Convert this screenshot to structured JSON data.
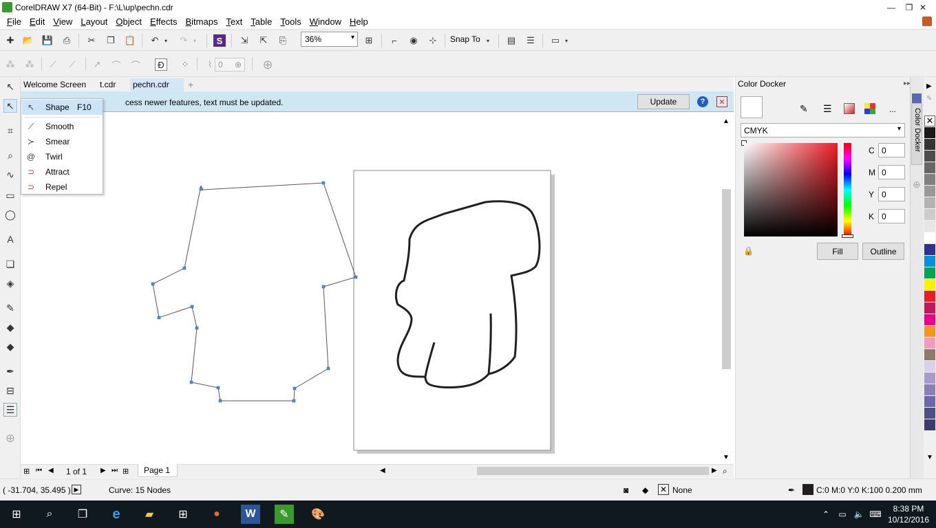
{
  "window": {
    "title": "CorelDRAW X7 (64-Bit) - F:\\L\\up\\pechn.cdr"
  },
  "menu": [
    {
      "label": "File",
      "key": "F",
      "rest": "ile"
    },
    {
      "label": "Edit",
      "key": "E",
      "rest": "dit"
    },
    {
      "label": "View",
      "key": "V",
      "rest": "iew"
    },
    {
      "label": "Layout",
      "key": "L",
      "rest": "ayout"
    },
    {
      "label": "Object",
      "key": "O",
      "rest": "bject"
    },
    {
      "label": "Effects",
      "key": "E",
      "rest": "ffects"
    },
    {
      "label": "Bitmaps",
      "key": "B",
      "rest": "itmaps"
    },
    {
      "label": "Text",
      "key": "T",
      "rest": "ext"
    },
    {
      "label": "Table",
      "key": "T",
      "rest": "able"
    },
    {
      "label": "Tools",
      "key": "T",
      "rest": "ools"
    },
    {
      "label": "Window",
      "key": "W",
      "rest": "indow"
    },
    {
      "label": "Help",
      "key": "H",
      "rest": "elp"
    }
  ],
  "toolbar": {
    "zoom": "36%",
    "snap_to": "Snap To",
    "nudge_value": "0"
  },
  "tabs": [
    {
      "label": "Welcome Screen"
    },
    {
      "label": "t.cdr"
    },
    {
      "label": "pechn.cdr"
    }
  ],
  "infobar": {
    "text": "cess newer features, text must be updated.",
    "update_label": "Update",
    "help_glyph": "?",
    "close_glyph": "✕"
  },
  "flyout": [
    {
      "label": "Shape",
      "shortcut": "F10",
      "icon": "shape-tool-icon"
    },
    {
      "label": "Smooth",
      "shortcut": "",
      "icon": "smooth-tool-icon"
    },
    {
      "label": "Smear",
      "shortcut": "",
      "icon": "smear-tool-icon"
    },
    {
      "label": "Twirl",
      "shortcut": "",
      "icon": "twirl-tool-icon"
    },
    {
      "label": "Attract",
      "shortcut": "",
      "icon": "attract-tool-icon"
    },
    {
      "label": "Repel",
      "shortcut": "",
      "icon": "repel-tool-icon"
    }
  ],
  "pagenav": {
    "page_count": "1 of 1",
    "page_tab": "Page 1"
  },
  "docker": {
    "title": "Color Docker",
    "vertical_tab": "Color Docker",
    "model": "CMYK",
    "channels": [
      {
        "label": "C",
        "value": "0"
      },
      {
        "label": "M",
        "value": "0"
      },
      {
        "label": "Y",
        "value": "0"
      },
      {
        "label": "K",
        "value": "0"
      }
    ],
    "fill_label": "Fill",
    "outline_label": "Outline",
    "more_label": "..."
  },
  "palette": [
    "#1a1a1a",
    "#333333",
    "#4d4d4d",
    "#666666",
    "#808080",
    "#999999",
    "#b3b3b3",
    "#cccccc",
    "#e6e6e6",
    "#ffffff",
    "#2e3192",
    "#0093dd",
    "#00a651",
    "#fff200",
    "#ed1c24",
    "#c2185b",
    "#ec008c",
    "#f7941d",
    "#f49ac1",
    "#8c7b6b",
    "#d7d2ea",
    "#a99bc9",
    "#8b7fb8",
    "#6d66a8",
    "#4e4f8a",
    "#3b3b6d"
  ],
  "status": {
    "coords": "( -31.704, 35.495 )",
    "selection": "Curve: 15 Nodes",
    "fill": "None",
    "outline": "C:0 M:0 Y:0 K:100  0.200 mm"
  },
  "clock": {
    "time": "8:38 PM",
    "date": "10/12/2016"
  },
  "colors": {
    "accent": "#3a9a2e",
    "infobar": "#cfe7f3",
    "tab_active": "#d5e6f7"
  }
}
